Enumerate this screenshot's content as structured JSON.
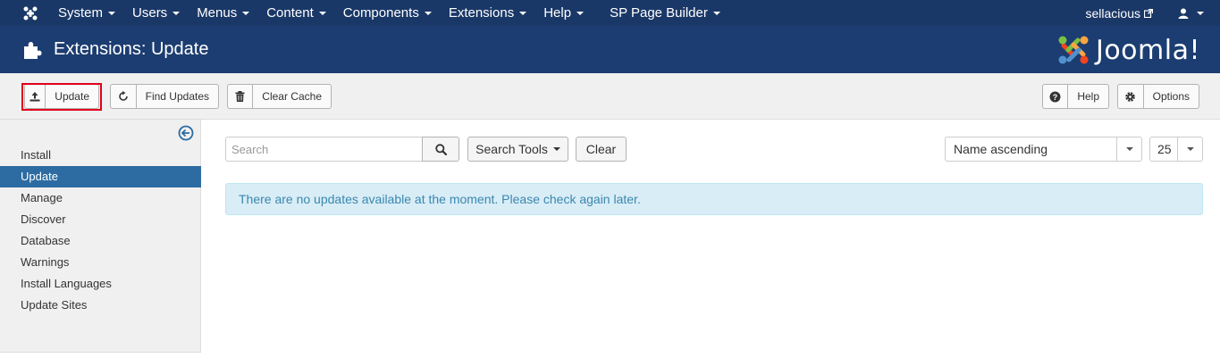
{
  "topnav": {
    "menu": [
      {
        "label": "System"
      },
      {
        "label": "Users"
      },
      {
        "label": "Menus"
      },
      {
        "label": "Content"
      },
      {
        "label": "Components"
      },
      {
        "label": "Extensions"
      },
      {
        "label": "Help"
      },
      {
        "label": "SP Page Builder"
      }
    ],
    "site_link": "sellacious",
    "user_icon": "user-icon"
  },
  "header": {
    "title": "Extensions: Update",
    "brand": "Joomla!"
  },
  "toolbar": {
    "update_label": "Update",
    "find_updates_label": "Find Updates",
    "clear_cache_label": "Clear Cache",
    "help_label": "Help",
    "options_label": "Options"
  },
  "sidebar": {
    "items": [
      {
        "label": "Install"
      },
      {
        "label": "Update"
      },
      {
        "label": "Manage"
      },
      {
        "label": "Discover"
      },
      {
        "label": "Database"
      },
      {
        "label": "Warnings"
      },
      {
        "label": "Install Languages"
      },
      {
        "label": "Update Sites"
      }
    ],
    "active": "Update"
  },
  "filters": {
    "search_placeholder": "Search",
    "search_tools_label": "Search Tools",
    "clear_label": "Clear",
    "ordering": "Name ascending",
    "limit": "25"
  },
  "message": "There are no updates available at the moment. Please check again later.",
  "colors": {
    "topnav_bg": "#1a3867",
    "header_bg": "#1c3d71",
    "active_item": "#2d6ca2",
    "alert_bg": "#d9edf7",
    "alert_text": "#3a87ad",
    "highlight": "#e0001a"
  }
}
